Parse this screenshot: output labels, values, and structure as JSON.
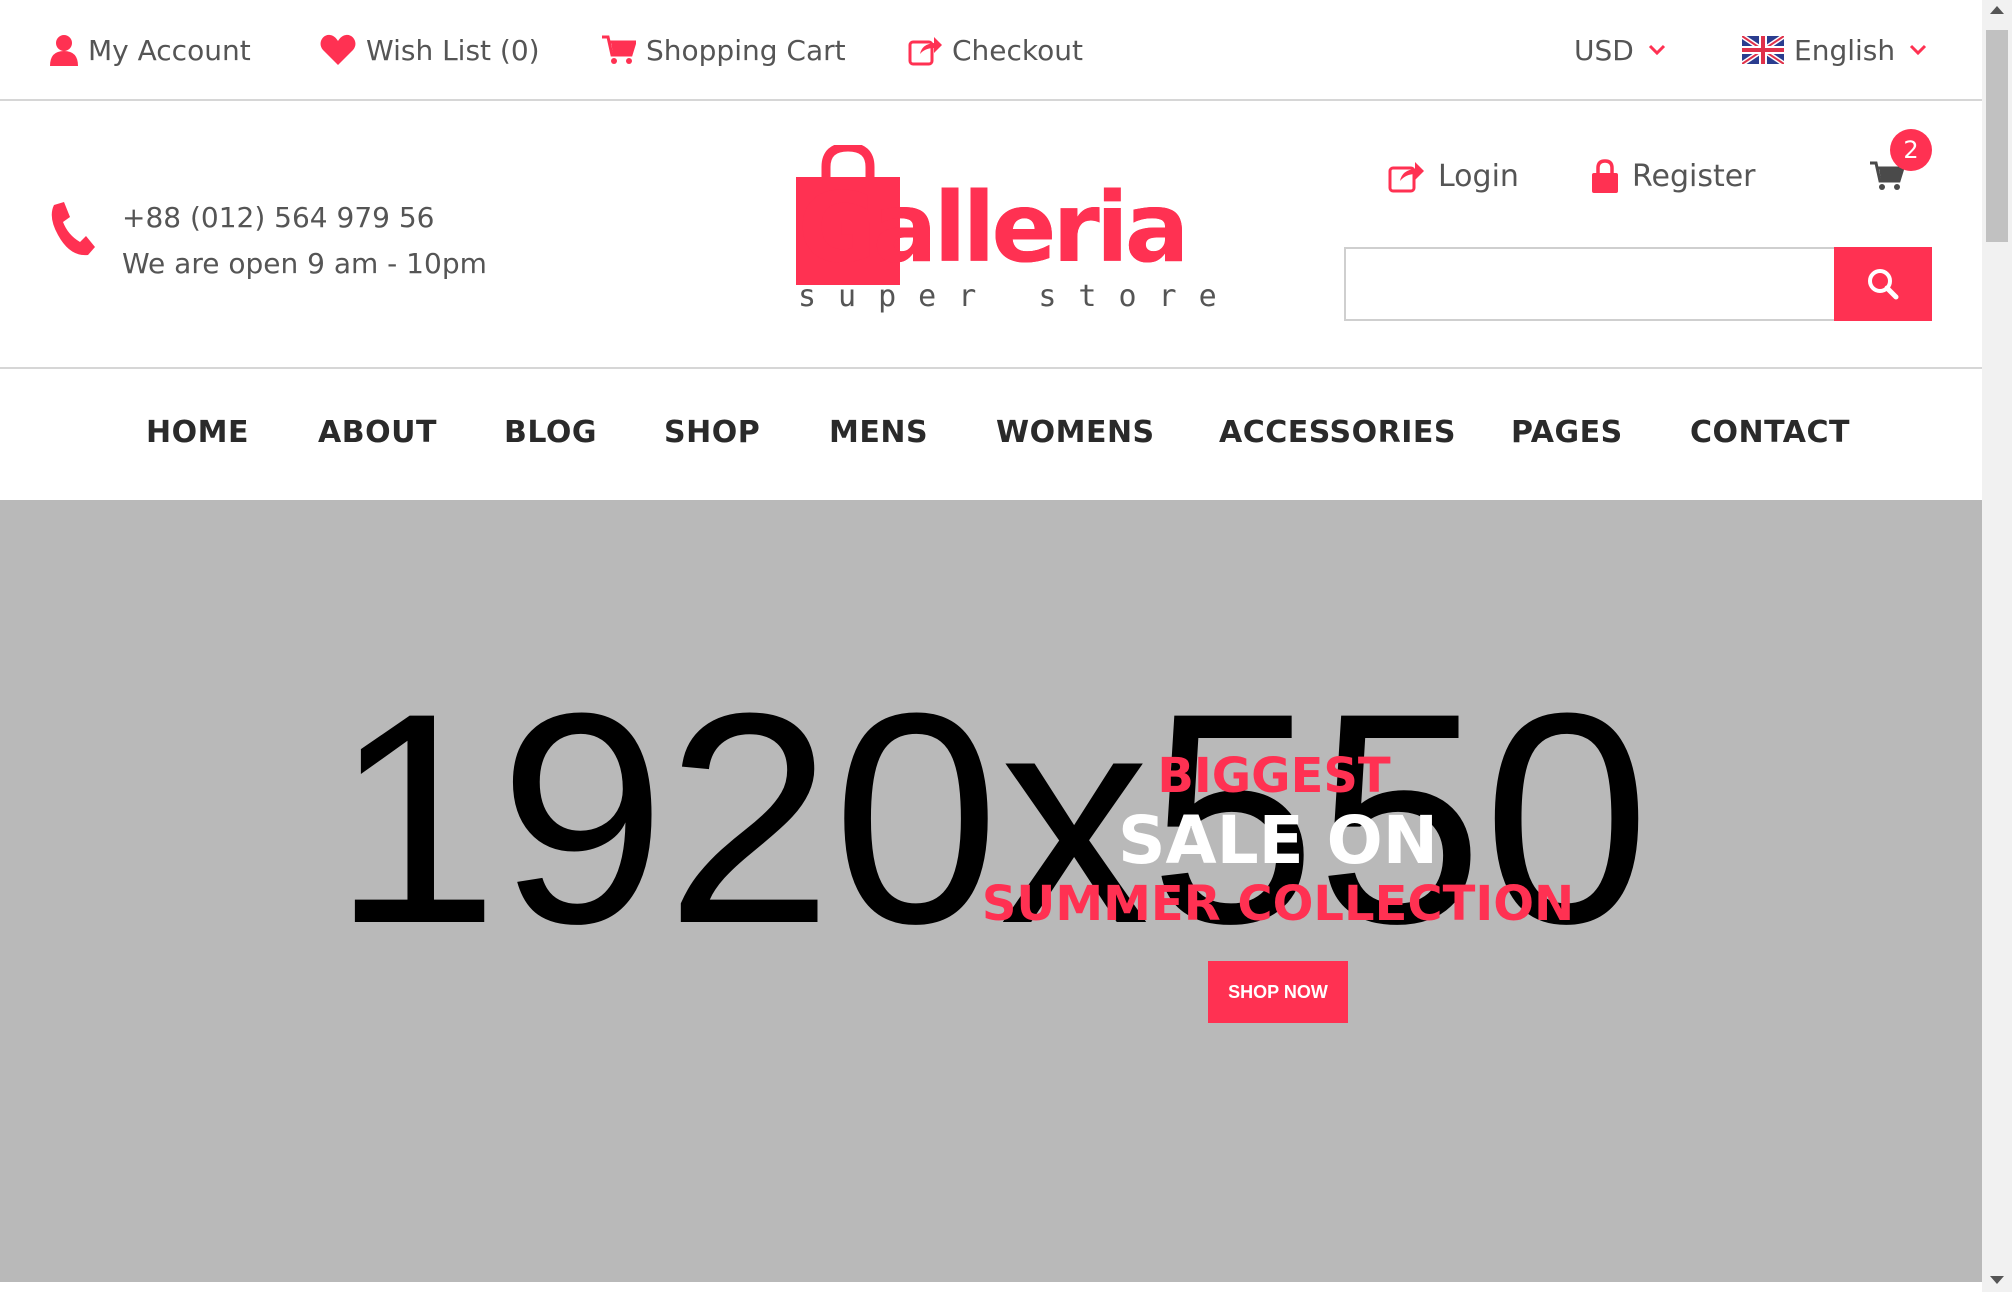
{
  "topbar": {
    "my_account": "My Account",
    "wish_list": "Wish List (0)",
    "shopping_cart": "Shopping Cart",
    "checkout": "Checkout",
    "currency": "USD",
    "language": "English"
  },
  "header": {
    "phone": "+88 (012) 564 979 56",
    "hours": "We are open 9 am - 10pm",
    "logo_word": "Galleria",
    "logo_sub": "super store",
    "login": "Login",
    "register": "Register",
    "cart_count": "2",
    "search_placeholder": ""
  },
  "nav": {
    "items": [
      "HOME",
      "ABOUT",
      "BLOG",
      "SHOP",
      "MENS",
      "WOMENS",
      "ACCESSORIES",
      "PAGES",
      "CONTACT"
    ]
  },
  "hero": {
    "placeholder": "1920x550",
    "line1": "BIGGEST",
    "line2": "SALE ON",
    "line3": "SUMMER COLLECTION",
    "button": "SHOP NOW"
  },
  "colors": {
    "accent": "#ff3152",
    "text": "#555555",
    "nav_text": "#2a2a2a",
    "hero_bg": "#b9b9b9"
  },
  "icons": [
    "user-icon",
    "heart-icon",
    "cart-icon",
    "checkout-share-icon",
    "chevron-down-icon",
    "uk-flag-icon",
    "phone-icon",
    "login-share-icon",
    "lock-icon",
    "search-icon"
  ]
}
